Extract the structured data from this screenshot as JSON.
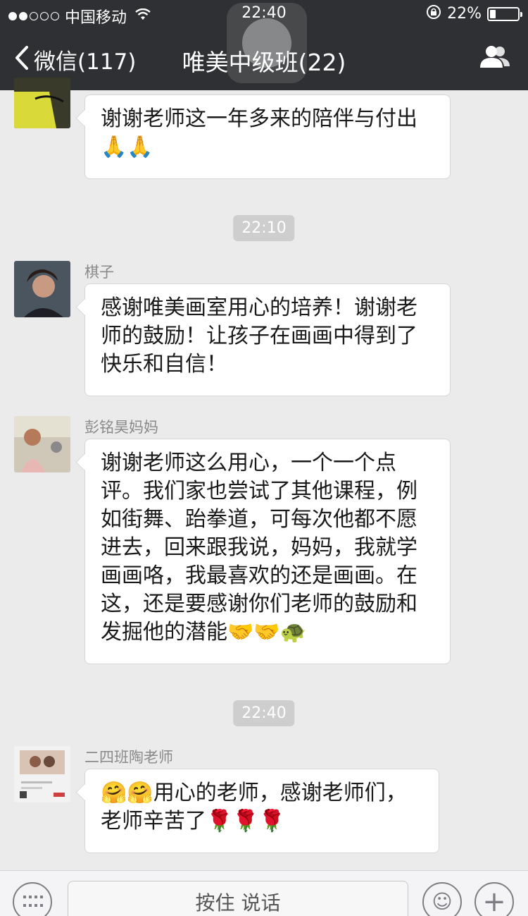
{
  "status_bar": {
    "carrier": "中国移动",
    "time": "22:40",
    "battery": "22%",
    "battery_level": 0.22,
    "signal_bars_filled": 2,
    "signal_bars_total": 5
  },
  "nav": {
    "back_label": "微信(117)",
    "title": "唯美中级班(22)"
  },
  "messages": [
    {
      "sender": "",
      "text_line1": "谢谢老师这一年多来的陪伴与付出",
      "text_line2": "🙏🙏"
    },
    {
      "timestamp": "22:10"
    },
    {
      "sender": "棋子",
      "text_line1": "感谢唯美画室用心的培养！谢谢老",
      "text_line2": "师的鼓励！让孩子在画画中得到了",
      "text_line3": "快乐和自信！"
    },
    {
      "sender": "彭铭昊妈妈",
      "text_line1": "谢谢老师这么用心，一个一个点",
      "text_line2": "评。我们家也尝试了其他课程，例",
      "text_line3": "如街舞、跆拳道，可每次他都不愿",
      "text_line4": "进去，回来跟我说，妈妈，我就学",
      "text_line5": "画画咯，我最喜欢的还是画画。在",
      "text_line6": "这，还是要感谢你们老师的鼓励和",
      "text_line7": "发掘他的潜能🤝🤝🐢"
    },
    {
      "timestamp": "22:40"
    },
    {
      "sender": "二四班陶老师",
      "text_line1": "🤗🤗用心的老师，感谢老师们，",
      "text_line2": "老师辛苦了🌹🌹🌹"
    }
  ],
  "input_bar": {
    "hold_to_talk": "按住 说话"
  },
  "colors": {
    "topbar": "#2e3033",
    "background": "#ebebeb",
    "bubble": "#ffffff"
  }
}
